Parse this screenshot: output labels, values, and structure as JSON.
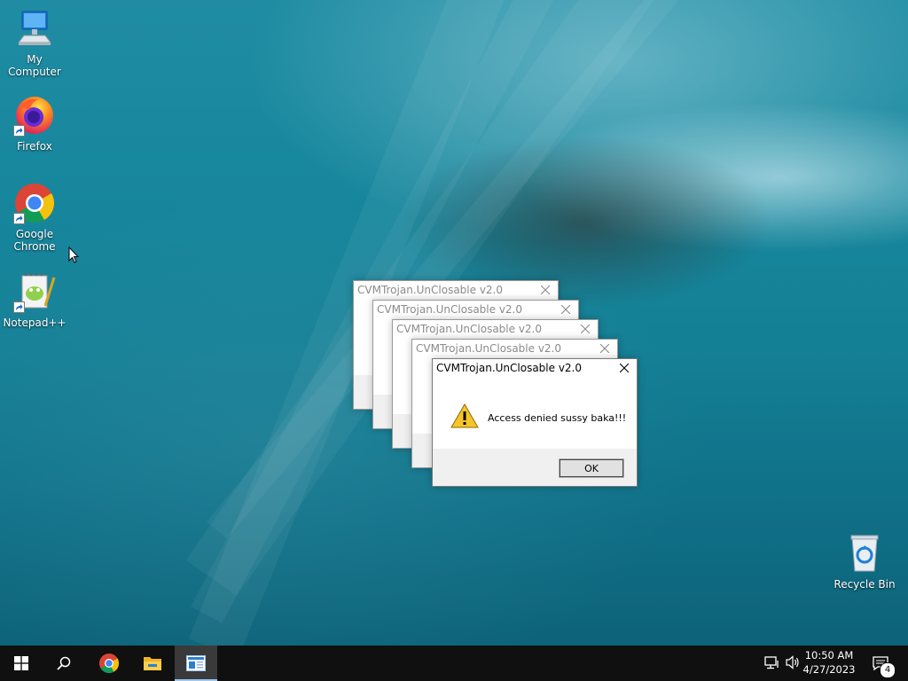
{
  "desktop": {
    "icons": [
      {
        "label": "My Computer",
        "icon": "computer-icon"
      },
      {
        "label": "Firefox",
        "icon": "firefox-icon"
      },
      {
        "label": "Google Chrome",
        "icon": "chrome-icon"
      },
      {
        "label": "Notepad++",
        "icon": "notepadpp-icon"
      },
      {
        "label": "Recycle Bin",
        "icon": "recycle-bin-icon"
      }
    ]
  },
  "dialogs": {
    "title": "CVMTrojan.UnClosable v2.0",
    "message": "Access denied sussy baka!!!",
    "ok_label": "OK"
  },
  "taskbar": {
    "time": "10:50 AM",
    "date": "4/27/2023",
    "notification_count": "4"
  },
  "colors": {
    "taskbar": "#101010",
    "active_underline": "#9bc6f0",
    "dialog_footer": "#f0f0f0"
  }
}
